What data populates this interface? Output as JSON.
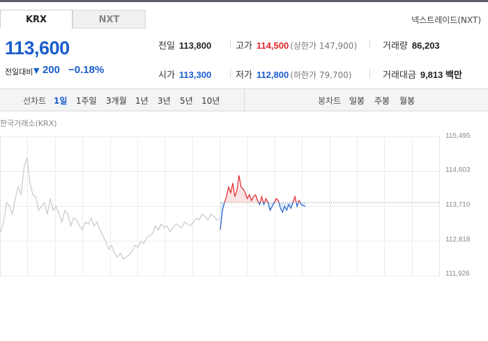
{
  "tabs": [
    {
      "label": "KRX",
      "active": true
    },
    {
      "label": "NXT",
      "active": false
    }
  ],
  "nxt_link": "넥스트레이드(NXT)",
  "price": {
    "current": "113,600",
    "change_label": "전일대비",
    "change_direction": "down",
    "change_value": "200",
    "change_pct": "−0.18%"
  },
  "stats": {
    "prev_close": {
      "label": "전일",
      "value": "113,800"
    },
    "high": {
      "label": "고가",
      "value": "114,500",
      "extra": "(상한가 147,900)"
    },
    "volume": {
      "label": "거래량",
      "value": "86,203"
    },
    "open": {
      "label": "시가",
      "value": "113,300"
    },
    "low": {
      "label": "저가",
      "value": "112,800",
      "extra": "(하한가 79,700)"
    },
    "amount": {
      "label": "거래대금",
      "value": "9,813 백만"
    }
  },
  "toolbar": {
    "line_chart_label": "선차트",
    "periods": [
      "1일",
      "1주일",
      "3개월",
      "1년",
      "3년",
      "5년",
      "10년"
    ],
    "active_period": "1일",
    "candle_label": "봉차트",
    "candle_periods": [
      "일봉",
      "주봉",
      "월봉"
    ]
  },
  "chart": {
    "market_label": "한국거래소(KRX)",
    "y_ticks": [
      "115,495",
      "114,603",
      "113,710",
      "112,818",
      "111,926"
    ],
    "colors": {
      "up": "#e0252b",
      "down": "#1a5dcc",
      "prev_day": "#c8c8c8"
    }
  },
  "chart_data": {
    "type": "line",
    "ylim": [
      111926,
      115495
    ],
    "reference_price": 113800,
    "y_ticks": [
      115495,
      114603,
      113710,
      112818,
      111926
    ],
    "series": [
      {
        "values": [
          113050,
          113300,
          113800,
          113700,
          113500,
          113900,
          114200,
          114000,
          114700,
          114950,
          114300,
          114000,
          113950,
          113600,
          113700,
          113800,
          113500,
          113900,
          113600,
          113700,
          113500,
          113300,
          113600,
          113500,
          113200,
          113400,
          113350,
          113200,
          113100,
          113300,
          113250,
          113400,
          113200,
          113300,
          113100,
          112950,
          112800,
          112600,
          112700,
          112500,
          112400,
          112500,
          112350,
          112400,
          112450,
          112550,
          112700,
          112650,
          112800,
          112750,
          112900,
          112950,
          113000,
          113200,
          113100,
          113250,
          113150,
          113200,
          113050,
          113150,
          113250,
          113200,
          113150,
          113300,
          113250,
          113200,
          113300,
          113400,
          113350,
          113500,
          113450,
          113350,
          113500,
          113450,
          113350,
          113400
        ]
      },
      {
        "values": [
          113100,
          113600,
          113800,
          113950,
          114200,
          114050,
          114300,
          113950,
          114100,
          114500,
          114200,
          114150,
          114050,
          113900,
          114000,
          113850,
          113950,
          114000,
          113850,
          113750,
          113950,
          113750,
          113900,
          113800,
          113600,
          113700,
          113800,
          113900,
          113850,
          113650,
          113550,
          113700,
          113600,
          113750,
          113650,
          113800,
          113950,
          113700,
          113850,
          113750,
          113720,
          113700
        ]
      }
    ]
  }
}
